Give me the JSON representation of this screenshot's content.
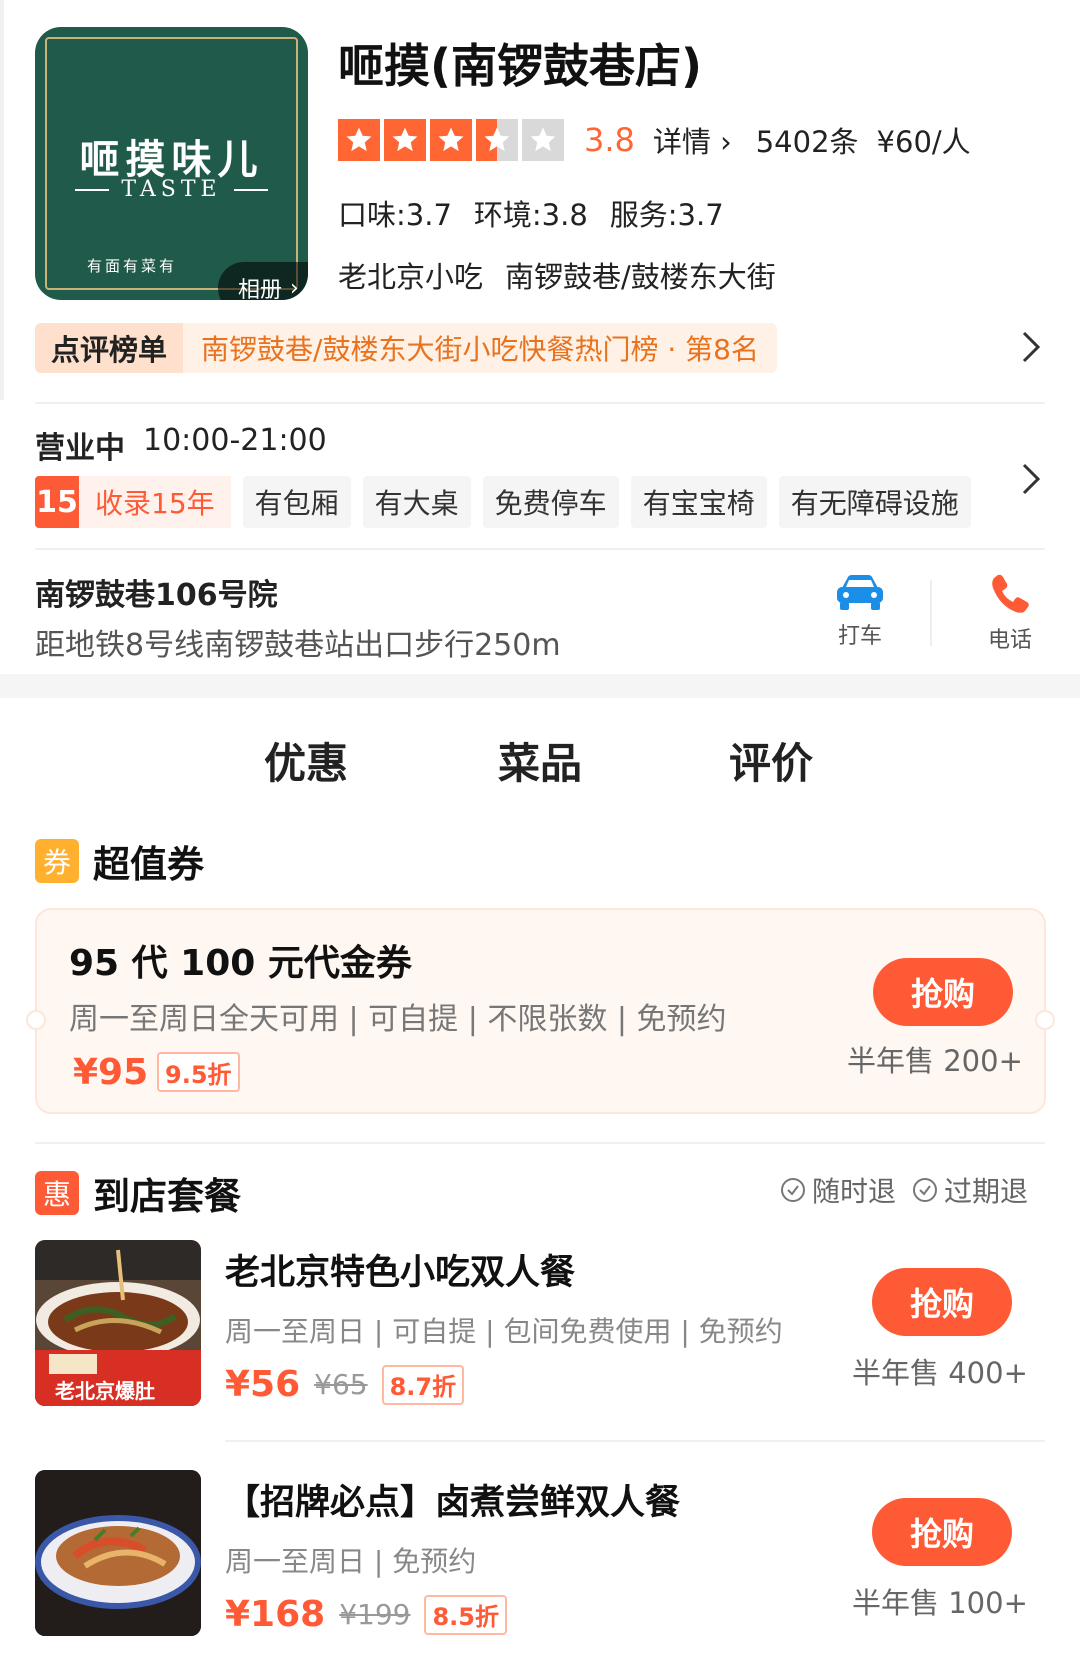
{
  "colors": {
    "accent": "#ff6633",
    "button": "#ff5a36",
    "logo_bg": "#1f5a4a"
  },
  "shop": {
    "logo": {
      "title": "咂摸味儿",
      "subtitle": "TASTE",
      "slogan": "有面有菜有"
    },
    "album_label": "相册",
    "name": "咂摸(南锣鼓巷店)",
    "rating": 3.8,
    "rating_label": "3.8",
    "stars": [
      "full",
      "full",
      "full",
      "half",
      "empty"
    ],
    "detail_label": "详情",
    "review_count": "5402条",
    "avg_price": "¥60/人",
    "scores": {
      "taste": "口味:3.7",
      "environment": "环境:3.8",
      "service": "服务:3.7"
    },
    "category": "老北京小吃",
    "area": "南锣鼓巷/鼓楼东大街",
    "ranking": {
      "label": "点评榜单",
      "text": "南锣鼓巷/鼓楼东大街小吃快餐热门榜 · 第8名"
    },
    "hours": {
      "status": "营业中",
      "time": "10:00-21:00"
    },
    "years": {
      "number": "15",
      "text": "收录15年"
    },
    "tags": [
      "有包厢",
      "有大桌",
      "免费停车",
      "有宝宝椅",
      "有无障碍设施"
    ],
    "address": "南锣鼓巷106号院",
    "metro": "距地铁8号线南锣鼓巷站出口步行250m",
    "taxi_label": "打车",
    "call_label": "电话"
  },
  "tabs": [
    {
      "label": "优惠",
      "active": true
    },
    {
      "label": "菜品",
      "active": false
    },
    {
      "label": "评价",
      "active": false
    }
  ],
  "voucher_section": {
    "icon_text": "券",
    "title": "超值券",
    "voucher": {
      "title": "95 代 100 元代金券",
      "rules": "周一至周日全天可用 | 可自提 | 不限张数 | 免预约",
      "price": "¥95",
      "discount": "9.5折",
      "buy_label": "抢购",
      "sold": "半年售 200+"
    }
  },
  "package_section": {
    "icon_text": "惠",
    "title": "到店套餐",
    "refund_tags": [
      "随时退",
      "过期退"
    ],
    "deals": [
      {
        "title": "老北京特色小吃双人餐",
        "rules": "周一至周日 | 可自提 | 包间免费使用 | 免预约",
        "price": "¥56",
        "original": "¥65",
        "discount": "8.7折",
        "buy_label": "抢购",
        "sold": "半年售 400+",
        "bowl_text": "老北京爆肚"
      },
      {
        "title": "【招牌必点】卤煮尝鲜双人餐",
        "rules": "周一至周日 | 免预约",
        "price": "¥168",
        "original": "¥199",
        "discount": "8.5折",
        "buy_label": "抢购",
        "sold": "半年售 100+"
      }
    ]
  }
}
